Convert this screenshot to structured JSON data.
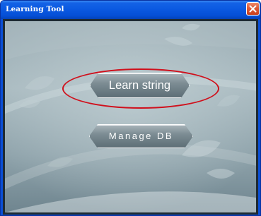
{
  "window": {
    "title": "Learning Tool",
    "close_icon": "close-icon"
  },
  "main": {
    "learn_button_label": "Learn string",
    "manage_button_label": "Manage DB"
  },
  "annotation": {
    "highlight_color": "#d0101c"
  },
  "colors": {
    "titlebar": "#0a58e0",
    "close_button": "#dd5a35",
    "panel": "#9aacb3"
  }
}
